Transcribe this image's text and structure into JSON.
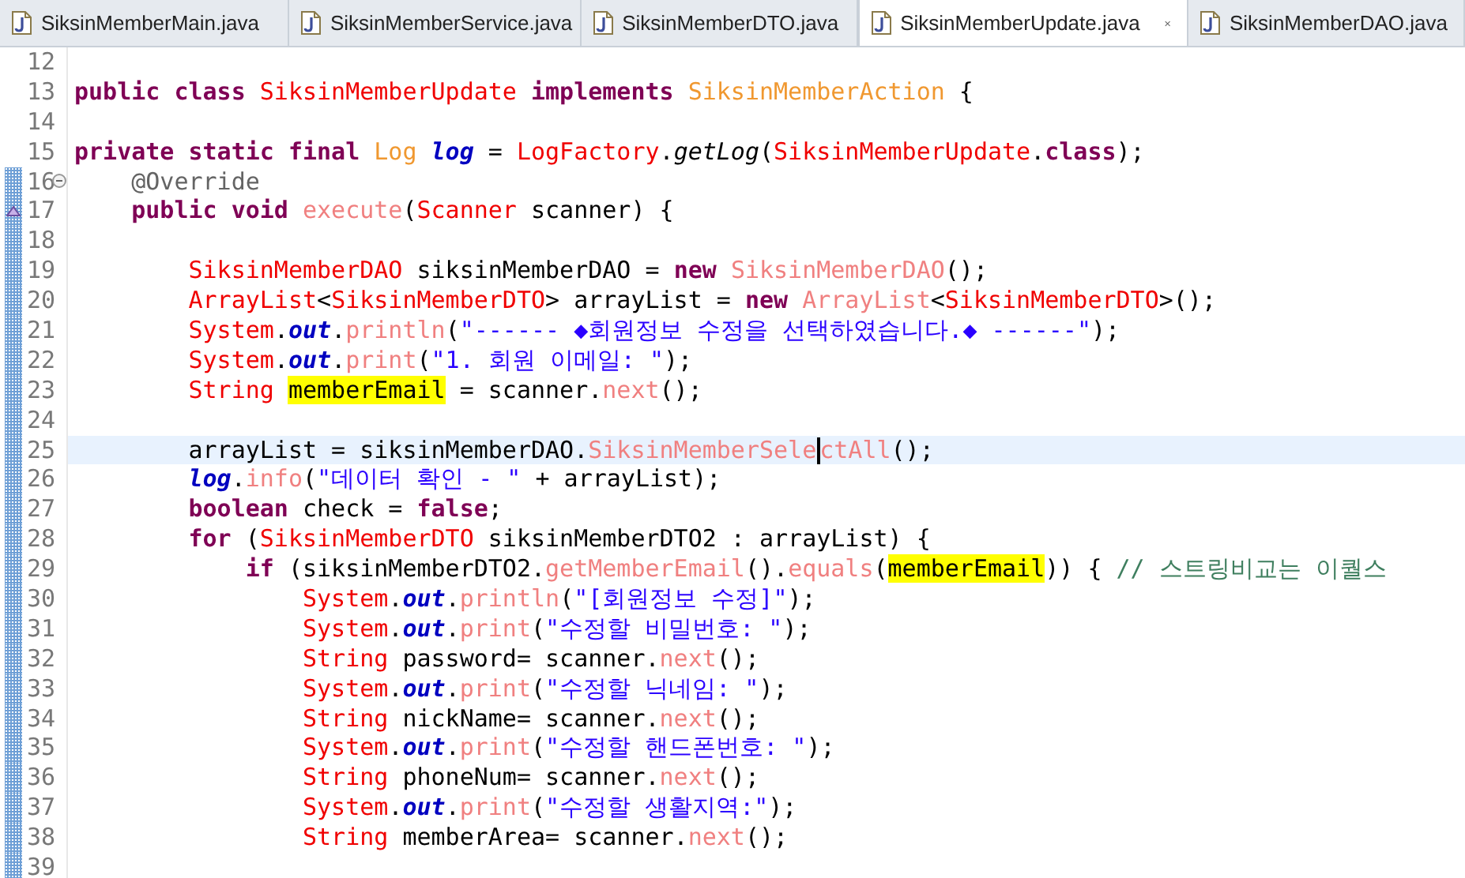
{
  "tabs": [
    {
      "label": "SiksinMemberMain.java",
      "selected": false
    },
    {
      "label": "SiksinMemberService.java",
      "selected": false
    },
    {
      "label": "SiksinMemberDTO.java",
      "selected": false
    },
    {
      "label": "SiksinMemberUpdate.java",
      "selected": true
    },
    {
      "label": "SiksinMemberDAO.java",
      "selected": false
    }
  ],
  "lines": [
    {
      "number": "12",
      "changed": false,
      "selected": false
    },
    {
      "number": "13",
      "changed": false,
      "selected": false,
      "tokens": [
        {
          "kind": "kw",
          "text": "public class "
        },
        {
          "kind": "type",
          "text": "SiksinMemberUpdate"
        },
        {
          "kind": "kw",
          "text": " implements "
        },
        {
          "kind": "iface",
          "text": "SiksinMemberAction"
        },
        {
          "kind": "plain",
          "text": " {"
        }
      ]
    },
    {
      "number": "14",
      "changed": false,
      "selected": false
    },
    {
      "number": "15",
      "changed": false,
      "selected": false,
      "tokens": [
        {
          "kind": "kw",
          "text": "private static final "
        },
        {
          "kind": "iface",
          "text": "Log"
        },
        {
          "kind": "sfield",
          "text": " log"
        },
        {
          "kind": "plain",
          "text": " = "
        },
        {
          "kind": "type",
          "text": "LogFactory"
        },
        {
          "kind": "plain",
          "text": "."
        },
        {
          "kind": "smethod",
          "text": "getLog"
        },
        {
          "kind": "plain",
          "text": "("
        },
        {
          "kind": "type",
          "text": "SiksinMemberUpdate"
        },
        {
          "kind": "plain",
          "text": "."
        },
        {
          "kind": "kw",
          "text": "class"
        },
        {
          "kind": "plain",
          "text": ");"
        }
      ]
    },
    {
      "number": "16",
      "changed": true,
      "selected": false,
      "kind": "fold",
      "tokens": [
        {
          "kind": "anno",
          "text": "    @Override"
        }
      ]
    },
    {
      "number": "17",
      "changed": true,
      "selected": false,
      "kind": "override",
      "tokens": [
        {
          "kind": "kw",
          "text": "    public void "
        },
        {
          "kind": "method",
          "text": "execute"
        },
        {
          "kind": "plain",
          "text": "("
        },
        {
          "kind": "type",
          "text": "Scanner"
        },
        {
          "kind": "plain",
          "text": " scanner) {"
        }
      ]
    },
    {
      "number": "18",
      "changed": true,
      "selected": false
    },
    {
      "number": "19",
      "changed": true,
      "selected": false,
      "tokens": [
        {
          "kind": "type",
          "text": "        SiksinMemberDAO"
        },
        {
          "kind": "plain",
          "text": " siksinMemberDAO = "
        },
        {
          "kind": "kw",
          "text": "new "
        },
        {
          "kind": "method",
          "text": "SiksinMemberDAO"
        },
        {
          "kind": "plain",
          "text": "();"
        }
      ]
    },
    {
      "number": "20",
      "changed": true,
      "selected": false,
      "tokens": [
        {
          "kind": "type",
          "text": "        ArrayList"
        },
        {
          "kind": "plain",
          "text": "<"
        },
        {
          "kind": "type",
          "text": "SiksinMemberDTO"
        },
        {
          "kind": "plain",
          "text": "> arrayList = "
        },
        {
          "kind": "kw",
          "text": "new "
        },
        {
          "kind": "method",
          "text": "ArrayList"
        },
        {
          "kind": "plain",
          "text": "<"
        },
        {
          "kind": "type",
          "text": "SiksinMemberDTO"
        },
        {
          "kind": "plain",
          "text": ">();"
        }
      ]
    },
    {
      "number": "21",
      "changed": true,
      "selected": false,
      "tokens": [
        {
          "kind": "type",
          "text": "        System"
        },
        {
          "kind": "plain",
          "text": "."
        },
        {
          "kind": "field",
          "text": "out"
        },
        {
          "kind": "plain",
          "text": "."
        },
        {
          "kind": "method",
          "text": "println"
        },
        {
          "kind": "plain",
          "text": "("
        },
        {
          "kind": "str",
          "text": "\"------ ◆회원정보 수정을 선택하였습니다.◆ ------\""
        },
        {
          "kind": "plain",
          "text": ");"
        }
      ]
    },
    {
      "number": "22",
      "changed": true,
      "selected": false,
      "tokens": [
        {
          "kind": "type",
          "text": "        System"
        },
        {
          "kind": "plain",
          "text": "."
        },
        {
          "kind": "field",
          "text": "out"
        },
        {
          "kind": "plain",
          "text": "."
        },
        {
          "kind": "method",
          "text": "print"
        },
        {
          "kind": "plain",
          "text": "("
        },
        {
          "kind": "str",
          "text": "\"1. 회원 이메일: \""
        },
        {
          "kind": "plain",
          "text": ");"
        }
      ]
    },
    {
      "number": "23",
      "changed": true,
      "selected": false,
      "tokens": [
        {
          "kind": "type",
          "text": "        String "
        },
        {
          "kind": "hl",
          "text": "memberEmail"
        },
        {
          "kind": "plain",
          "text": " = scanner."
        },
        {
          "kind": "method",
          "text": "next"
        },
        {
          "kind": "plain",
          "text": "();"
        }
      ]
    },
    {
      "number": "24",
      "changed": true,
      "selected": false
    },
    {
      "number": "25",
      "changed": true,
      "selected": true,
      "tokens": [
        {
          "kind": "plain",
          "text": "        arrayList = siksinMemberDAO."
        },
        {
          "kind": "method_caret",
          "text": "SiksinMemberSele"
        },
        {
          "kind": "method",
          "text": "ctAll"
        },
        {
          "kind": "plain",
          "text": "();"
        }
      ]
    },
    {
      "number": "26",
      "changed": true,
      "selected": false,
      "tokens": [
        {
          "kind": "sfield",
          "text": "        log"
        },
        {
          "kind": "plain",
          "text": "."
        },
        {
          "kind": "method",
          "text": "info"
        },
        {
          "kind": "plain",
          "text": "("
        },
        {
          "kind": "str",
          "text": "\"데이터 확인 - \""
        },
        {
          "kind": "plain",
          "text": " + arrayList);"
        }
      ]
    },
    {
      "number": "27",
      "changed": true,
      "selected": false,
      "tokens": [
        {
          "kind": "kw",
          "text": "        boolean"
        },
        {
          "kind": "plain",
          "text": " check = "
        },
        {
          "kind": "kw",
          "text": "false"
        },
        {
          "kind": "plain",
          "text": ";"
        }
      ]
    },
    {
      "number": "28",
      "changed": true,
      "selected": false,
      "tokens": [
        {
          "kind": "kw",
          "text": "        for"
        },
        {
          "kind": "plain",
          "text": " ("
        },
        {
          "kind": "type",
          "text": "SiksinMemberDTO"
        },
        {
          "kind": "plain",
          "text": " siksinMemberDTO2 : arrayList) {"
        }
      ]
    },
    {
      "number": "29",
      "changed": true,
      "selected": false,
      "tokens": [
        {
          "kind": "kw",
          "text": "            if"
        },
        {
          "kind": "plain",
          "text": " (siksinMemberDTO2."
        },
        {
          "kind": "method",
          "text": "getMemberEmail"
        },
        {
          "kind": "plain",
          "text": "()."
        },
        {
          "kind": "method",
          "text": "equals"
        },
        {
          "kind": "plain",
          "text": "("
        },
        {
          "kind": "hl",
          "text": "memberEmail"
        },
        {
          "kind": "plain",
          "text": ")) { "
        },
        {
          "kind": "comment",
          "text": "// 스트링비교는 이퀄스"
        }
      ]
    },
    {
      "number": "30",
      "changed": true,
      "selected": false,
      "tokens": [
        {
          "kind": "type",
          "text": "                System"
        },
        {
          "kind": "plain",
          "text": "."
        },
        {
          "kind": "field",
          "text": "out"
        },
        {
          "kind": "plain",
          "text": "."
        },
        {
          "kind": "method",
          "text": "println"
        },
        {
          "kind": "plain",
          "text": "("
        },
        {
          "kind": "str",
          "text": "\"[회원정보 수정]\""
        },
        {
          "kind": "plain",
          "text": ");"
        }
      ]
    },
    {
      "number": "31",
      "changed": true,
      "selected": false,
      "tokens": [
        {
          "kind": "type",
          "text": "                System"
        },
        {
          "kind": "plain",
          "text": "."
        },
        {
          "kind": "field",
          "text": "out"
        },
        {
          "kind": "plain",
          "text": "."
        },
        {
          "kind": "method",
          "text": "print"
        },
        {
          "kind": "plain",
          "text": "("
        },
        {
          "kind": "str",
          "text": "\"수정할 비밀번호: \""
        },
        {
          "kind": "plain",
          "text": ");"
        }
      ]
    },
    {
      "number": "32",
      "changed": true,
      "selected": false,
      "tokens": [
        {
          "kind": "type",
          "text": "                String"
        },
        {
          "kind": "plain",
          "text": " password= scanner."
        },
        {
          "kind": "method",
          "text": "next"
        },
        {
          "kind": "plain",
          "text": "();"
        }
      ]
    },
    {
      "number": "33",
      "changed": true,
      "selected": false,
      "tokens": [
        {
          "kind": "type",
          "text": "                System"
        },
        {
          "kind": "plain",
          "text": "."
        },
        {
          "kind": "field",
          "text": "out"
        },
        {
          "kind": "plain",
          "text": "."
        },
        {
          "kind": "method",
          "text": "print"
        },
        {
          "kind": "plain",
          "text": "("
        },
        {
          "kind": "str",
          "text": "\"수정할 닉네임: \""
        },
        {
          "kind": "plain",
          "text": ");"
        }
      ]
    },
    {
      "number": "34",
      "changed": true,
      "selected": false,
      "tokens": [
        {
          "kind": "type",
          "text": "                String"
        },
        {
          "kind": "plain",
          "text": " nickName= scanner."
        },
        {
          "kind": "method",
          "text": "next"
        },
        {
          "kind": "plain",
          "text": "();"
        }
      ]
    },
    {
      "number": "35",
      "changed": true,
      "selected": false,
      "tokens": [
        {
          "kind": "type",
          "text": "                System"
        },
        {
          "kind": "plain",
          "text": "."
        },
        {
          "kind": "field",
          "text": "out"
        },
        {
          "kind": "plain",
          "text": "."
        },
        {
          "kind": "method",
          "text": "print"
        },
        {
          "kind": "plain",
          "text": "("
        },
        {
          "kind": "str",
          "text": "\"수정할 핸드폰번호: \""
        },
        {
          "kind": "plain",
          "text": ");"
        }
      ]
    },
    {
      "number": "36",
      "changed": true,
      "selected": false,
      "tokens": [
        {
          "kind": "type",
          "text": "                String"
        },
        {
          "kind": "plain",
          "text": " phoneNum= scanner."
        },
        {
          "kind": "method",
          "text": "next"
        },
        {
          "kind": "plain",
          "text": "();"
        }
      ]
    },
    {
      "number": "37",
      "changed": true,
      "selected": false,
      "tokens": [
        {
          "kind": "type",
          "text": "                System"
        },
        {
          "kind": "plain",
          "text": "."
        },
        {
          "kind": "field",
          "text": "out"
        },
        {
          "kind": "plain",
          "text": "."
        },
        {
          "kind": "method",
          "text": "print"
        },
        {
          "kind": "plain",
          "text": "("
        },
        {
          "kind": "str",
          "text": "\"수정할 생활지역:\""
        },
        {
          "kind": "plain",
          "text": ");"
        }
      ]
    },
    {
      "number": "38",
      "changed": true,
      "selected": false,
      "tokens": [
        {
          "kind": "type",
          "text": "                String"
        },
        {
          "kind": "plain",
          "text": " memberArea= scanner."
        },
        {
          "kind": "method",
          "text": "next"
        },
        {
          "kind": "plain",
          "text": "();"
        }
      ]
    },
    {
      "number": "39",
      "changed": true,
      "selected": false
    }
  ]
}
